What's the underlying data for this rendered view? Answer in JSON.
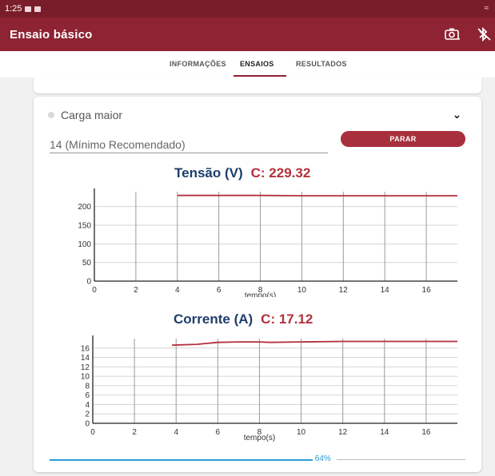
{
  "status_bar": {
    "time": "1:25"
  },
  "app_bar": {
    "title": "Ensaio básico"
  },
  "tabs": [
    {
      "label": "INFORMAÇÕES",
      "active": false
    },
    {
      "label": "ENSAIOS",
      "active": true
    },
    {
      "label": "RESULTADOS",
      "active": false
    }
  ],
  "step": {
    "label": "Carga maior"
  },
  "input": {
    "value": "14 (Mínimo Recomendado)"
  },
  "stop_button": {
    "label": "PARAR"
  },
  "colors": {
    "brand": "#8e2333",
    "line": "#b3303c",
    "title_blue": "#1d3d6b",
    "progress": "#2a9bd6"
  },
  "chart_data": [
    {
      "type": "line",
      "title_name": "Tensão (V)",
      "title_value": "C: 229.32",
      "xlabel": "tempo(s)",
      "ylabel": "",
      "xlim": [
        0,
        17.5
      ],
      "ylim": [
        0,
        240
      ],
      "xticks": [
        0,
        2,
        4,
        6,
        8,
        10,
        12,
        14,
        16
      ],
      "yticks": [
        0,
        50,
        100,
        150,
        200
      ],
      "grid": true,
      "series": [
        {
          "x": [
            4,
            6,
            8,
            10,
            12,
            14,
            16,
            17.5
          ],
          "y": [
            230,
            230,
            230,
            229,
            229,
            229,
            229,
            229
          ]
        }
      ]
    },
    {
      "type": "line",
      "title_name": "Corrente (A)",
      "title_value": "C: 17.12",
      "xlabel": "tempo(s)",
      "ylabel": "",
      "xlim": [
        0,
        17.5
      ],
      "ylim": [
        0,
        18
      ],
      "xticks": [
        0,
        2,
        4,
        6,
        8,
        10,
        12,
        14,
        16
      ],
      "yticks": [
        0,
        2,
        4,
        6,
        8,
        10,
        12,
        14,
        16
      ],
      "grid": true,
      "series": [
        {
          "x": [
            3.8,
            5,
            6,
            7,
            8,
            8.5,
            10,
            12,
            14,
            16,
            17.5
          ],
          "y": [
            16.6,
            16.8,
            17.2,
            17.3,
            17.3,
            17.2,
            17.3,
            17.4,
            17.4,
            17.4,
            17.4
          ]
        }
      ]
    }
  ],
  "progress": {
    "value": 64,
    "label": "64%"
  }
}
